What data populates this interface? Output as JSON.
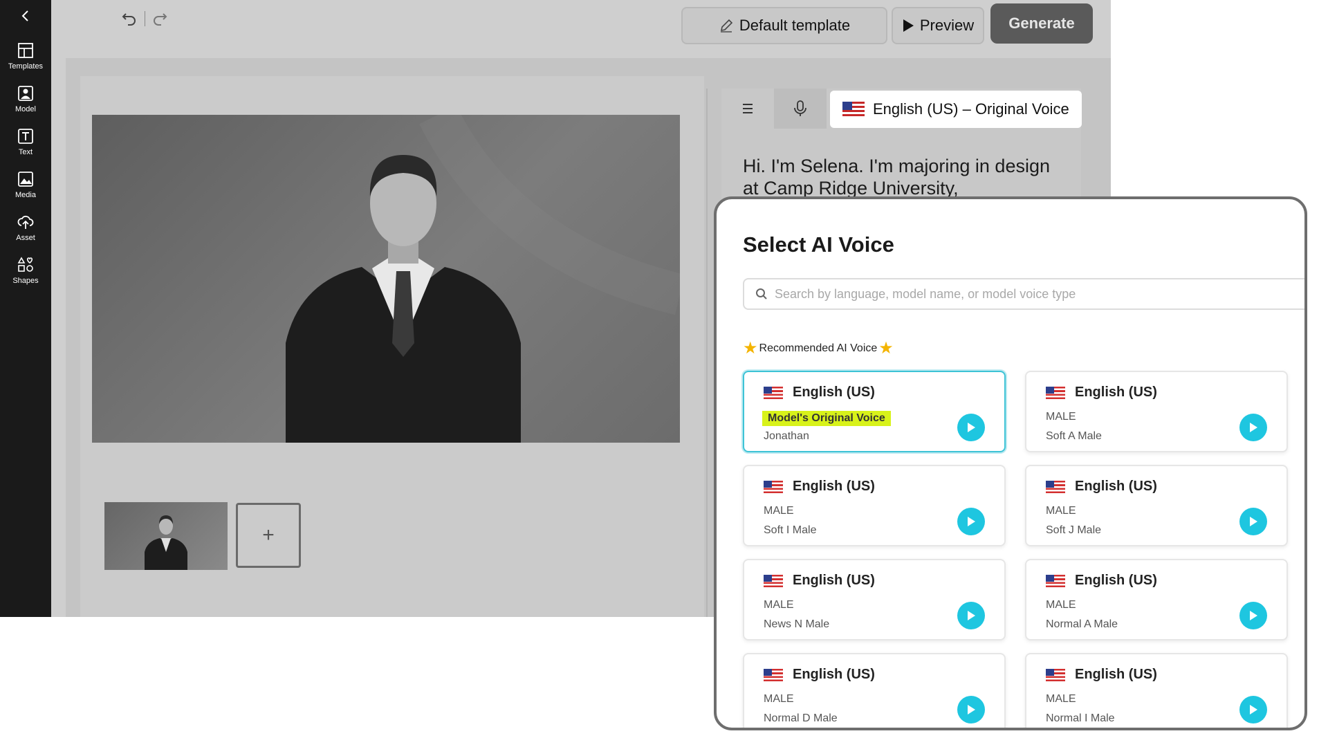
{
  "sidebar": {
    "items": [
      {
        "label": "Templates",
        "icon": "templates-icon"
      },
      {
        "label": "Model",
        "icon": "model-icon"
      },
      {
        "label": "Text",
        "icon": "text-icon"
      },
      {
        "label": "Media",
        "icon": "media-icon"
      },
      {
        "label": "Asset",
        "icon": "asset-upload-icon"
      },
      {
        "label": "Shapes",
        "icon": "shapes-icon"
      }
    ]
  },
  "toolbar": {
    "template_label": "Default template",
    "preview_label": "Preview",
    "generate_label": "Generate"
  },
  "script": {
    "voice_label": "English (US) – Original Voice",
    "text": "Hi. I'm Selena. I'm majoring in design at Camp Ridge University,"
  },
  "scenes": {
    "add_label": "+"
  },
  "modal": {
    "title": "Select AI Voice",
    "search_placeholder": "Search by language, model name, or model voice type",
    "recommended_label": "Recommended AI Voice",
    "cards": [
      {
        "language": "English (US)",
        "line1": "Model's Original Voice",
        "line2": "Jonathan",
        "selected": true
      },
      {
        "language": "English (US)",
        "line1": "MALE",
        "line2": "Soft A Male",
        "selected": false
      },
      {
        "language": "English (US)",
        "line1": "MALE",
        "line2": "Soft I Male",
        "selected": false
      },
      {
        "language": "English (US)",
        "line1": "MALE",
        "line2": "Soft J Male",
        "selected": false
      },
      {
        "language": "English (US)",
        "line1": "MALE",
        "line2": "News N Male",
        "selected": false
      },
      {
        "language": "English (US)",
        "line1": "MALE",
        "line2": "Normal A Male",
        "selected": false
      },
      {
        "language": "English (US)",
        "line1": "MALE",
        "line2": "Normal D Male",
        "selected": false
      },
      {
        "language": "English (US)",
        "line1": "MALE",
        "line2": "Normal I Male",
        "selected": false
      }
    ]
  },
  "colors": {
    "accent": "#1ec6e0",
    "highlight": "#d8f21a",
    "sidebar": "#1a1a1a",
    "generate": "#5a5a5a"
  }
}
